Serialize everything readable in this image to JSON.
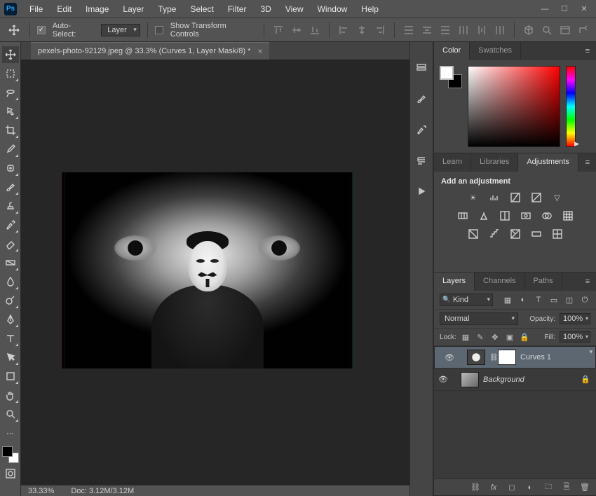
{
  "app": {
    "badge": "Ps"
  },
  "menu": [
    "File",
    "Edit",
    "Image",
    "Layer",
    "Type",
    "Select",
    "Filter",
    "3D",
    "View",
    "Window",
    "Help"
  ],
  "options": {
    "autoselect_label": "Auto-Select:",
    "autoselect_checked": true,
    "target": "Layer",
    "show_transform_label": "Show Transform Controls",
    "show_transform_checked": false
  },
  "document": {
    "tab_title": "pexels-photo-92129.jpeg @ 33.3% (Curves 1, Layer Mask/8) *",
    "zoom": "33.33%",
    "doc_size": "Doc: 3.12M/3.12M"
  },
  "panel_tabs": {
    "color": "Color",
    "swatches": "Swatches",
    "learn": "Learn",
    "libraries": "Libraries",
    "adjustments": "Adjustments",
    "layers": "Layers",
    "channels": "Channels",
    "paths": "Paths"
  },
  "adjustments": {
    "title": "Add an adjustment"
  },
  "layers": {
    "filter_kind": "Kind",
    "blend_mode": "Normal",
    "opacity_label": "Opacity:",
    "opacity_value": "100%",
    "lock_label": "Lock:",
    "fill_label": "Fill:",
    "fill_value": "100%",
    "items": [
      {
        "name": "Curves 1",
        "kind": "adjustment",
        "selected": true,
        "locked": false
      },
      {
        "name": "Background",
        "kind": "raster",
        "selected": false,
        "locked": true,
        "italic": true
      }
    ]
  }
}
